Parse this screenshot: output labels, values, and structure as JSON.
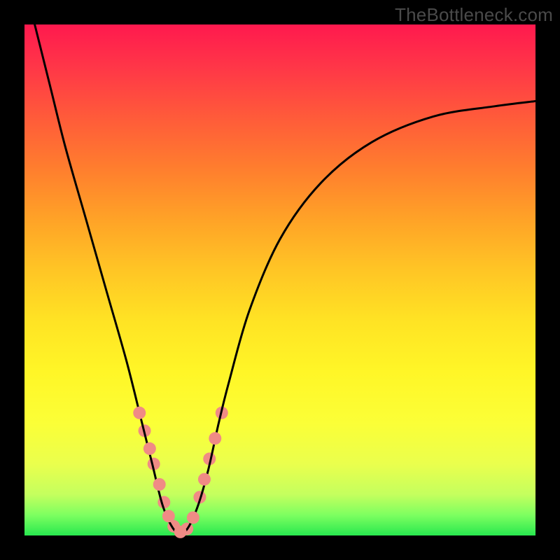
{
  "watermark": "TheBottleneck.com",
  "chart_data": {
    "type": "line",
    "title": "",
    "xlabel": "",
    "ylabel": "",
    "xlim": [
      0,
      100
    ],
    "ylim": [
      0,
      100
    ],
    "grid": false,
    "series": [
      {
        "name": "curve",
        "x": [
          2,
          5,
          8,
          12,
          16,
          20,
          23,
          25,
          27,
          29,
          30.5,
          32,
          34,
          36,
          38,
          40,
          44,
          50,
          58,
          68,
          80,
          92,
          100
        ],
        "y": [
          100,
          88,
          76,
          62,
          48,
          34,
          22,
          14,
          6,
          1.5,
          0.5,
          1.5,
          6,
          13,
          22,
          30,
          44,
          58,
          69,
          77,
          82,
          84,
          85
        ],
        "stroke": "#000000",
        "stroke_width": 3
      }
    ],
    "markers": {
      "name": "highlight-dots",
      "color": "#f08b85",
      "radius": 9,
      "points": [
        {
          "x": 22.5,
          "y": 24
        },
        {
          "x": 23.5,
          "y": 20.5
        },
        {
          "x": 24.5,
          "y": 17
        },
        {
          "x": 25.3,
          "y": 14
        },
        {
          "x": 26.4,
          "y": 10
        },
        {
          "x": 27.3,
          "y": 6.5
        },
        {
          "x": 28.2,
          "y": 3.8
        },
        {
          "x": 29.2,
          "y": 1.8
        },
        {
          "x": 30.5,
          "y": 0.7
        },
        {
          "x": 31.8,
          "y": 1.3
        },
        {
          "x": 33.0,
          "y": 3.5
        },
        {
          "x": 34.3,
          "y": 7.5
        },
        {
          "x": 35.2,
          "y": 11
        },
        {
          "x": 36.2,
          "y": 15
        },
        {
          "x": 37.3,
          "y": 19
        },
        {
          "x": 38.6,
          "y": 24
        }
      ]
    }
  }
}
